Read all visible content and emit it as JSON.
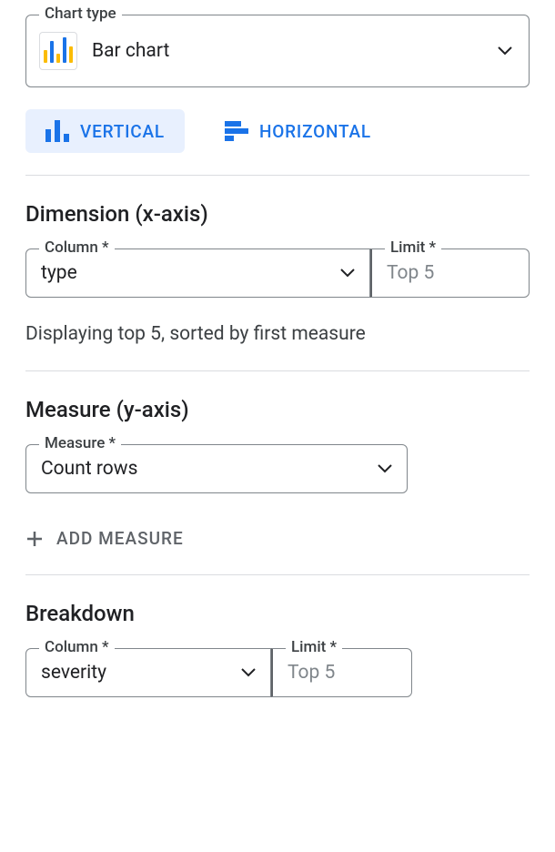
{
  "chart_type": {
    "legend": "Chart type",
    "value": "Bar chart"
  },
  "orientation": {
    "vertical": "VERTICAL",
    "horizontal": "HORIZONTAL"
  },
  "dimension": {
    "title": "Dimension (x-axis)",
    "column_legend": "Column *",
    "column_value": "type",
    "limit_legend": "Limit *",
    "limit_value": "Top 5",
    "caption": "Displaying top 5, sorted by first measure"
  },
  "measure": {
    "title": "Measure (y-axis)",
    "legend": "Measure *",
    "value": "Count rows",
    "add_label": "ADD MEASURE"
  },
  "breakdown": {
    "title": "Breakdown",
    "column_legend": "Column *",
    "column_value": "severity",
    "limit_legend": "Limit *",
    "limit_value": "Top 5"
  }
}
